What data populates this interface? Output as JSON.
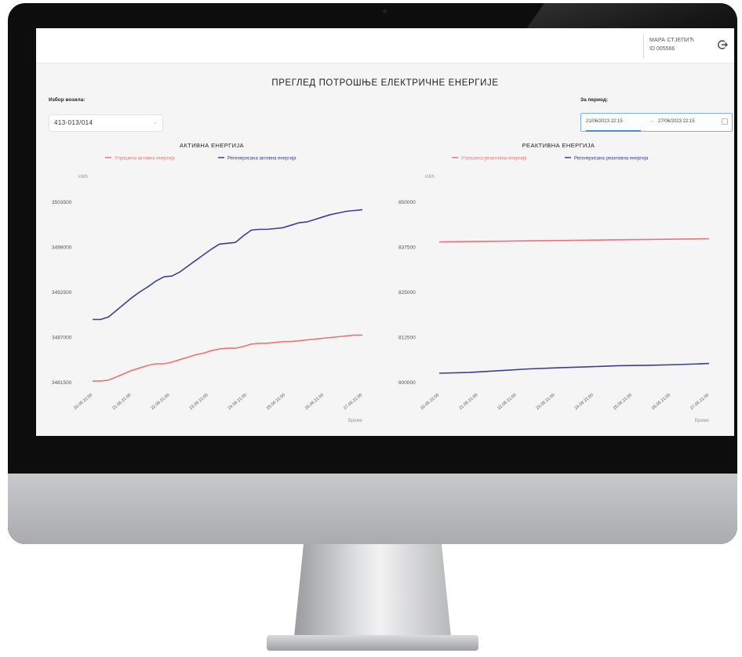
{
  "header": {
    "user_name": "МАРА СТЈЕПИЋ",
    "user_id": "ID 005566",
    "logout_icon": "logout-icon"
  },
  "page": {
    "title": "ПРЕГЛЕД ПОТРОШЊЕ ЕЛЕКТРИЧНЕ ЕНЕРГИЈЕ"
  },
  "filters": {
    "meter_label": "Избор возила:",
    "meter_value": "413-013/014",
    "period_label": "За период:",
    "date_from": "21/06/2023 22:15",
    "date_separator": "→",
    "date_to": "27/06/2023 22:15"
  },
  "colors": {
    "consumed": "#e8737a",
    "regenerated": "#3b3f94",
    "axis_text": "#555555"
  },
  "chart_data": [
    {
      "type": "line",
      "title": "АКТИВНА ЕНЕРГИЈА",
      "ylabel": "kWh",
      "xlabel": "Време",
      "ylim": [
        3481500,
        3503500
      ],
      "y_ticks": [
        3481500,
        3487000,
        3492500,
        3498000,
        3503500
      ],
      "x_tick_labels": [
        "20.06 22:00",
        "21.06 21:00",
        "22.06 21:00",
        "23.06 21:00",
        "24.06 21:00",
        "25.06 21:00",
        "26.06 21:00",
        "27.06 21:00"
      ],
      "legend_position": "top-center",
      "series": [
        {
          "name": "Утрошена активна енергија",
          "color": "#e8737a",
          "values": [
            3481700,
            3481700,
            3481800,
            3482200,
            3482600,
            3483000,
            3483300,
            3483600,
            3483800,
            3483800,
            3484000,
            3484300,
            3484600,
            3484900,
            3485100,
            3485400,
            3485600,
            3485700,
            3485700,
            3485900,
            3486200,
            3486300,
            3486300,
            3486400,
            3486500,
            3486500,
            3486600,
            3486700,
            3486800,
            3486900,
            3487000,
            3487100,
            3487200,
            3487300,
            3487300
          ]
        },
        {
          "name": "Регенерисана активна енергија",
          "color": "#3b3f94",
          "values": [
            3489200,
            3489200,
            3489500,
            3490300,
            3491100,
            3491900,
            3492600,
            3493200,
            3493900,
            3494400,
            3494500,
            3495000,
            3495700,
            3496400,
            3497100,
            3497800,
            3498400,
            3498500,
            3498600,
            3499400,
            3500100,
            3500200,
            3500200,
            3500300,
            3500400,
            3500700,
            3501000,
            3501100,
            3501400,
            3501700,
            3502000,
            3502200,
            3502400,
            3502500,
            3502600
          ]
        }
      ]
    },
    {
      "type": "line",
      "title": "РЕАКТИВНА ЕНЕРГИЈА",
      "ylabel": "kWh",
      "xlabel": "Време",
      "ylim": [
        800000,
        850000
      ],
      "y_ticks": [
        800000,
        812500,
        825000,
        837500,
        850000
      ],
      "x_tick_labels": [
        "20.06 22:00",
        "21.06 21:00",
        "22.06 21:00",
        "23.06 21:00",
        "24.06 21:00",
        "25.06 21:00",
        "26.06 21:00",
        "27.06 21:00"
      ],
      "legend_position": "top-center",
      "series": [
        {
          "name": "Утрошена реактивна енергија",
          "color": "#e8737a",
          "values": [
            839000,
            839100,
            839200,
            839300,
            839400,
            839500,
            839600,
            839700,
            839800,
            839900
          ]
        },
        {
          "name": "Регенерисана реактивна енергија",
          "color": "#3b3f94",
          "values": [
            802600,
            802800,
            803300,
            803800,
            804100,
            804400,
            804700,
            804800,
            805000,
            805300
          ]
        }
      ]
    }
  ]
}
